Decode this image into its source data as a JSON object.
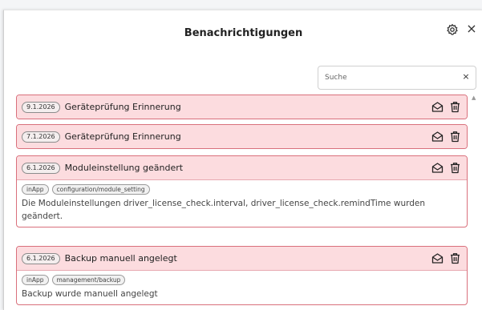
{
  "header": {
    "title": "Benachrichtigungen"
  },
  "search": {
    "placeholder": "Suche",
    "clear": "×"
  },
  "close_glyph": "×",
  "scroll_glyph": "▲",
  "notifications": [
    {
      "date": "9.1.2026",
      "title": "Geräteprüfung Erinnerung"
    },
    {
      "date": "7.1.2026",
      "title": "Geräteprüfung Erinnerung"
    },
    {
      "date": "6.1.2026",
      "title": "Moduleinstellung geändert",
      "tags": [
        "inApp",
        "configuration/module_setting"
      ],
      "message": "Die Moduleinstellungen driver_license_check.interval, driver_license_check.remindTime wurden geändert."
    },
    {
      "date": "6.1.2026",
      "title": "Backup manuell angelegt",
      "tags": [
        "inApp",
        "management/backup"
      ],
      "message": "Backup wurde manuell angelegt"
    }
  ],
  "colors": {
    "card_border": "#d9707c",
    "card_header": "#fcdcdf"
  },
  "icons": [
    "settings-gear-icon",
    "close-icon",
    "mark-read-envelope-icon",
    "trash-icon"
  ]
}
